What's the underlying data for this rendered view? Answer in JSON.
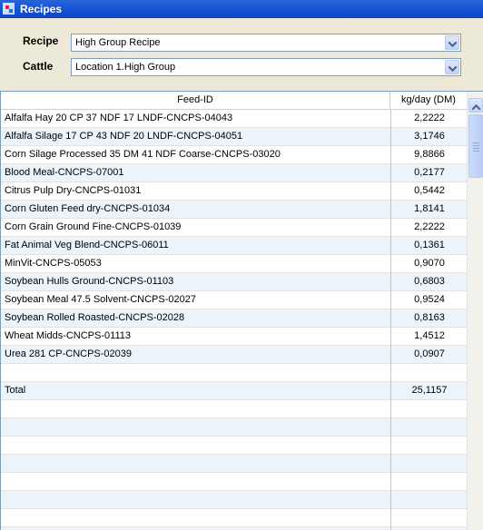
{
  "window": {
    "title": "Recipes"
  },
  "form": {
    "recipe_label": "Recipe",
    "recipe_value": "High Group Recipe",
    "cattle_label": "Cattle",
    "cattle_value": "Location 1.High Group"
  },
  "grid": {
    "columns": [
      "Feed-ID",
      "kg/day (DM)"
    ],
    "rows": [
      {
        "feed": "Alfalfa Hay 20 CP 37 NDF 17 LNDF-CNCPS-04043",
        "kg": "2,2222"
      },
      {
        "feed": "Alfalfa Silage 17 CP 43 NDF 20 LNDF-CNCPS-04051",
        "kg": "3,1746"
      },
      {
        "feed": "Corn Silage Processed 35 DM 41 NDF Coarse-CNCPS-03020",
        "kg": "9,8866"
      },
      {
        "feed": "Blood Meal-CNCPS-07001",
        "kg": "0,2177"
      },
      {
        "feed": "Citrus Pulp Dry-CNCPS-01031",
        "kg": "0,5442"
      },
      {
        "feed": "Corn Gluten Feed dry-CNCPS-01034",
        "kg": "1,8141"
      },
      {
        "feed": "Corn Grain Ground Fine-CNCPS-01039",
        "kg": "2,2222"
      },
      {
        "feed": "Fat Animal Veg Blend-CNCPS-06011",
        "kg": "0,1361"
      },
      {
        "feed": "MinVit-CNCPS-05053",
        "kg": "0,9070"
      },
      {
        "feed": "Soybean Hulls Ground-CNCPS-01103",
        "kg": "0,6803"
      },
      {
        "feed": "Soybean Meal 47.5 Solvent-CNCPS-02027",
        "kg": "0,9524"
      },
      {
        "feed": "Soybean Rolled Roasted-CNCPS-02028",
        "kg": "0,8163"
      },
      {
        "feed": "Wheat Midds-CNCPS-01113",
        "kg": "1,4512"
      },
      {
        "feed": "Urea 281 CP-CNCPS-02039",
        "kg": "0,0907"
      },
      {
        "feed": "",
        "kg": ""
      },
      {
        "feed": "Total",
        "kg": "25,1157"
      },
      {
        "feed": "",
        "kg": ""
      },
      {
        "feed": "",
        "kg": ""
      },
      {
        "feed": "",
        "kg": ""
      },
      {
        "feed": "",
        "kg": ""
      },
      {
        "feed": "",
        "kg": ""
      },
      {
        "feed": "",
        "kg": ""
      },
      {
        "feed": "",
        "kg": ""
      },
      {
        "feed": "",
        "kg": ""
      }
    ]
  }
}
